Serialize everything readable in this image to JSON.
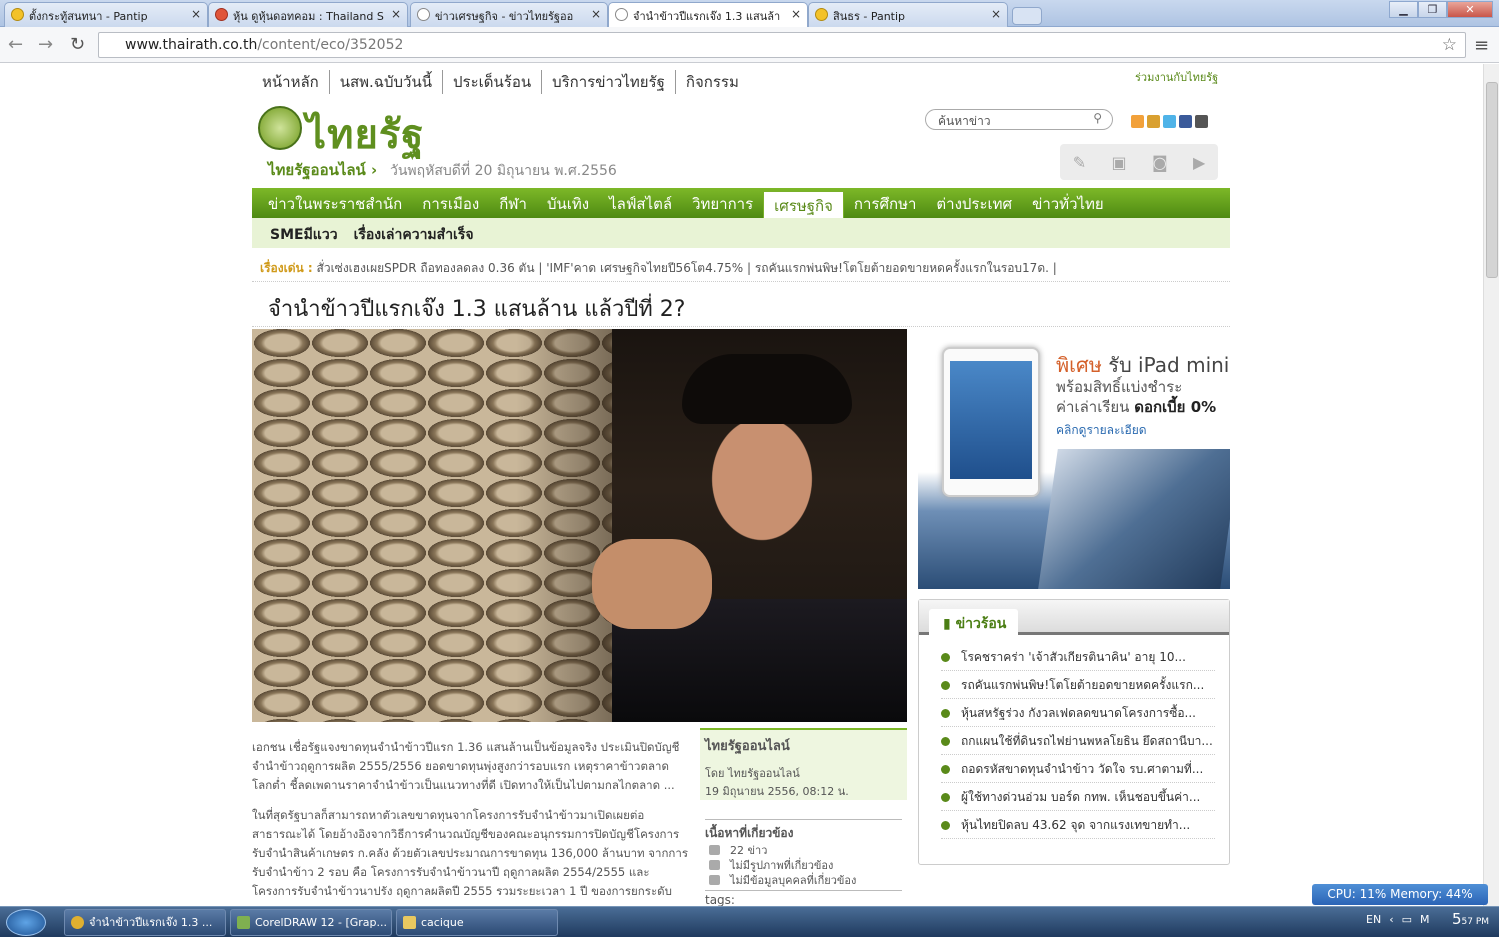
{
  "browser": {
    "tabs": [
      {
        "title": "ตั้งกระทู้สนทนา - Pantip"
      },
      {
        "title": "หุ้น ดูหุ้นดอทคอม : Thailand S"
      },
      {
        "title": "ข่าวเศรษฐกิจ - ข่าวไทยรัฐออ"
      },
      {
        "title": "จำนำข้าวปีแรกเจ๊ง 1.3 แสนล้า"
      },
      {
        "title": "สินธร - Pantip"
      }
    ],
    "close_glyph": "×",
    "url_domain": "www.thairath.co.th",
    "url_path": "/content/eco/352052"
  },
  "site": {
    "top_nav": [
      "หน้าหลัก",
      "นสพ.ฉบับวันนี้",
      "ประเด็นร้อน",
      "บริการข่าวไทยรัฐ",
      "กิจกรรม"
    ],
    "top_link": "ร่วมงานกับไทยรัฐ",
    "logo_text": "ไทยรัฐ",
    "site_name": "ไทยรัฐออนไลน์",
    "date": "วันพฤหัสบดีที่ 20 มิถุนายน พ.ศ.2556",
    "search_placeholder": "ค้นหาข่าว",
    "main_nav": [
      "ข่าวในพระราชสำนัก",
      "การเมือง",
      "กีฬา",
      "บันเทิง",
      "ไลฟ์สไตล์",
      "วิทยาการ",
      "เศรษฐกิจ",
      "การศึกษา",
      "ต่างประเทศ",
      "ข่าวทั่วไทย"
    ],
    "main_nav_active": "เศรษฐกิจ",
    "sub_nav": [
      "SMEมีแวว",
      "เรื่องเล่าความสำเร็จ"
    ],
    "ticker_label": "เรื่องเด่น :",
    "ticker": "สั่วเซ่งเฮงเผยSPDR ถือทองลดลง 0.36 ตัน  |  'IMF'คาด เศรษฐกิจไทยปี56โต4.75%  |  รถคันแรกพ่นพิษ!โตโยต้ายอดขายหดครั้งแรกในรอบ17ด.  |"
  },
  "article": {
    "headline": "จำนำข้าวปีแรกเจ๊ง 1.3 แสนล้าน แล้วปีที่ 2?",
    "para1": "เอกชน เชื่อรัฐแจงขาดทุนจำนำข้าวปีแรก 1.36 แสนล้านเป็นข้อมูลจริง ประเมินปิดบัญชีจำนำข้าวฤดูการผลิต 2555/2556 ยอดขาดทุนพุ่งสูงกว่ารอบแรก เหตุราคาข้าวตลาดโลกต่ำ ชี้ลดเพดานราคาจำนำข้าวเป็นแนวทางที่ดี เปิดทางให้เป็นไปตามกลไกตลาด ...",
    "para2": "ในที่สุดรัฐบาลก็สามารถหาตัวเลขขาดทุนจากโครงการรับจำนำข้าวมาเปิดเผยต่อสาธารณะได้ โดยอ้างอิงจากวิธีการคำนวณบัญชีของคณะอนุกรรมการปิดบัญชีโครงการรับจำนำสินค้าเกษตร ก.คลัง ด้วยตัวเลขประมาณการขาดทุน 136,000 ล้านบาท จากการรับจำนำข้าว 2 รอบ คือ โครงการรับจำนำข้าวนาปี ฤดูกาลผลิต 2554/2555 และโครงการรับจำนำข้าวนาปรัง ฤดูกาลผลิตปี 2555 รวมระยะเวลา 1 ปี ของการยกระดับ",
    "source_title": "ไทยรัฐออนไลน์",
    "source_by": "โดย ไทยรัฐออนไลน์",
    "source_date": "19 มิถุนายน 2556, 08:12 น.",
    "related_title": "เนื้อหาที่เกี่ยวข้อง",
    "related": [
      "22 ข่าว",
      "ไม่มีรูปภาพที่เกี่ยวข้อง",
      "ไม่มีข้อมูลบุคคลที่เกี่ยวข้อง"
    ],
    "tags_label": "tags:"
  },
  "ad": {
    "line1a": "พิเศษ",
    "line1b": " รับ iPad mini",
    "line2": "พร้อมสิทธิ์แบ่งชำระ",
    "line3a": "ค่าเล่าเรียน ",
    "line3b": "ดอกเบี้ย 0%",
    "line4": "คลิกดูรายละเอียด"
  },
  "hot_news": {
    "title": "ข่าวร้อน",
    "items": [
      "โรคชราคร่า 'เจ้าสัวเกียรตินาคิน' อายุ 10...",
      "รถคันแรกพ่นพิษ!โตโยต้ายอดขายหดครั้งแรก...",
      "หุ้นสหรัฐร่วง กังวลเฟดลดขนาดโครงการซื้อ...",
      "ถกแผนใช้ที่ดินรถไฟย่านพหลโยธิน ยึดสถานีบา...",
      "ถอดรหัสขาดทุนจำนำข้าว วัดใจ รบ.ศาตามที่...",
      "ผู้ใช้ทางด่วนอ่วม บอร์ด กทพ. เห็นชอบขึ้นค่า...",
      "หุ้นไทยปิดลบ 43.62 จุด จากแรงเทขายทำ..."
    ]
  },
  "system": {
    "cpu_memory": "CPU: 11%  Memory: 44%",
    "taskbar": [
      "จำนำข้าวปีแรกเจ๊ง 1.3 ...",
      "CorelDRAW 12 - [Grap...",
      "cacique"
    ],
    "lang": "EN",
    "time": "5",
    "time_min": "57",
    "ampm": "PM"
  }
}
